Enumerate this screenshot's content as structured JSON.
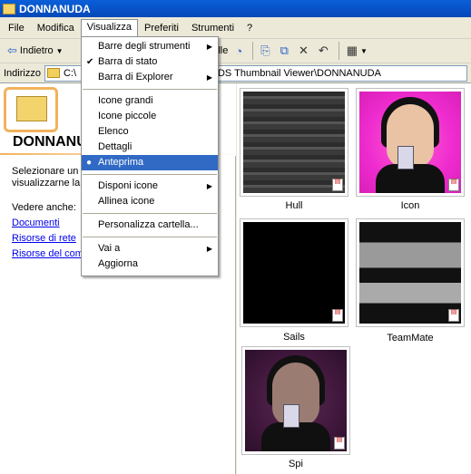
{
  "window": {
    "title": "DONNANUDA"
  },
  "menubar": {
    "items": [
      "File",
      "Modifica",
      "Visualizza",
      "Preferiti",
      "Strumenti",
      "?"
    ]
  },
  "toolbar": {
    "back_label": "Indietro",
    "folders_label": "rtelle"
  },
  "address": {
    "label": "Indirizzo",
    "path_left": "C:\\",
    "path_right": "DDS Thumbnail Viewer\\DONNANUDA"
  },
  "left_pane": {
    "folder_title": "DONNANUDA",
    "desc_line1": "Selezionare un e",
    "desc_line2": "visualizzarne la",
    "see_also": "Vedere anche:",
    "links": [
      "Documenti",
      "Risorse di rete",
      "Risorse del comp"
    ]
  },
  "menu_visualizza": {
    "items": [
      {
        "label": "Barre degli strumenti",
        "submenu": true
      },
      {
        "label": "Barra di stato",
        "checked": true
      },
      {
        "label": "Barra di Explorer",
        "submenu": true
      },
      {
        "label": "Icone grandi"
      },
      {
        "label": "Icone piccole"
      },
      {
        "label": "Elenco"
      },
      {
        "label": "Dettagli"
      },
      {
        "label": "Anteprima",
        "radio": true,
        "selected": true
      },
      {
        "label": "Disponi icone",
        "submenu": true
      },
      {
        "label": "Allinea icone"
      },
      {
        "label": "Personalizza cartella..."
      },
      {
        "label": "Vai a",
        "submenu": true
      },
      {
        "label": "Aggiorna"
      }
    ]
  },
  "thumbnails": [
    {
      "name": "Hull"
    },
    {
      "name": "Icon"
    },
    {
      "name": "Sails"
    },
    {
      "name": "TeamMate"
    },
    {
      "name": "Spi"
    }
  ],
  "colors": {
    "title_bar": "#0a5fd8",
    "menu_highlight": "#316ac5",
    "link": "#0000ee"
  }
}
